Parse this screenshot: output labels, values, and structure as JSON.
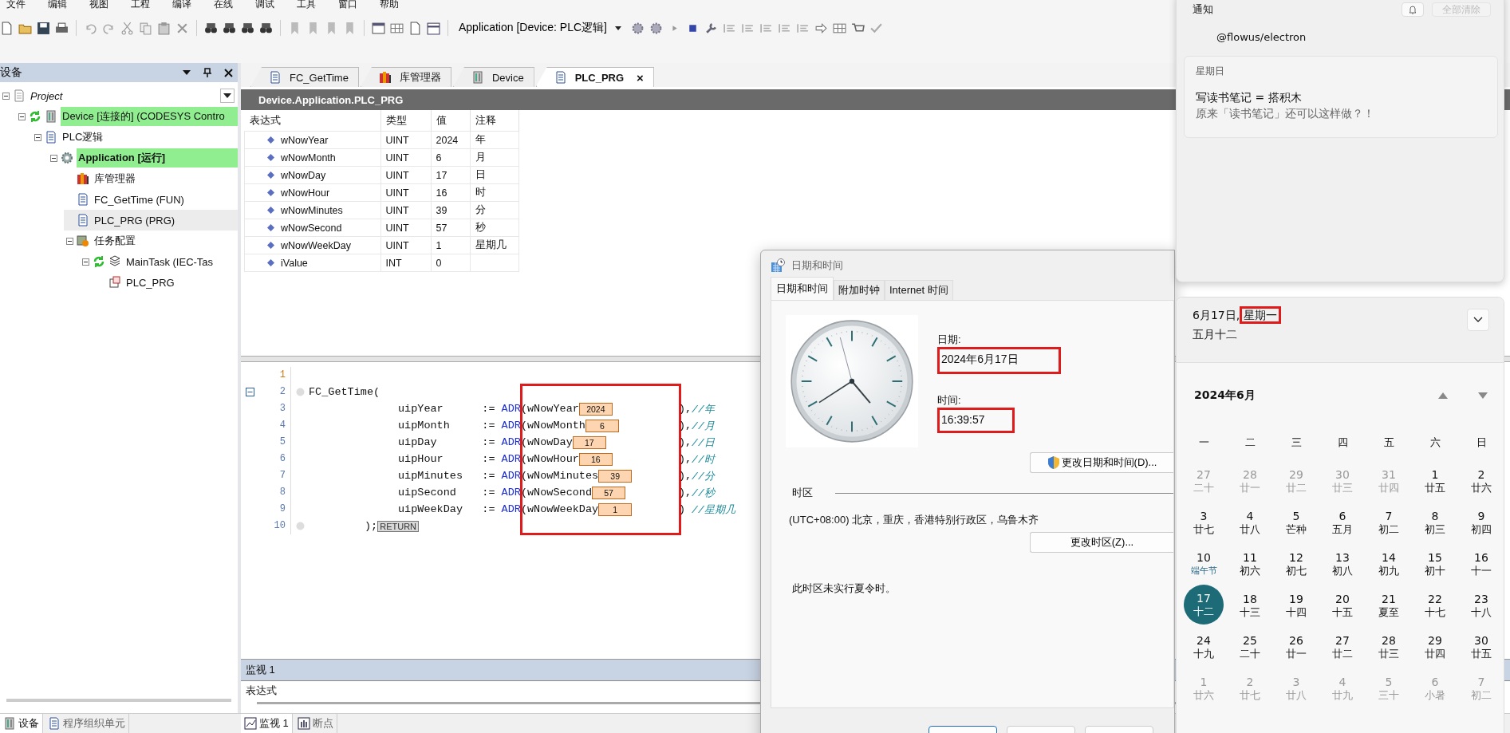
{
  "menu": [
    "文件",
    "编辑",
    "视图",
    "工程",
    "编译",
    "在线",
    "调试",
    "工具",
    "窗口",
    "帮助"
  ],
  "toolbar": {
    "target": "Application [Device: PLC逻辑]"
  },
  "devices_panel": {
    "title": "设备",
    "tree": [
      {
        "label": "Project",
        "kind": "project",
        "expanded": true,
        "selected": false,
        "highlight": false,
        "children": [
          {
            "label": "Device [连接的] (CODESYS Contro",
            "kind": "device",
            "expanded": true,
            "selected": false,
            "highlight": true,
            "children": [
              {
                "label": "PLC逻辑",
                "kind": "plc",
                "expanded": true,
                "selected": false,
                "highlight": false,
                "children": [
                  {
                    "label": "Application [运行]",
                    "kind": "application",
                    "expanded": true,
                    "selected": false,
                    "highlight": true,
                    "children": [
                      {
                        "label": "库管理器",
                        "kind": "library",
                        "selected": false,
                        "highlight": false
                      },
                      {
                        "label": "FC_GetTime (FUN)",
                        "kind": "pou",
                        "selected": false,
                        "highlight": false
                      },
                      {
                        "label": "PLC_PRG (PRG)",
                        "kind": "pou",
                        "selected": true,
                        "highlight": false
                      },
                      {
                        "label": "任务配置",
                        "kind": "taskconfig",
                        "expanded": true,
                        "selected": false,
                        "highlight": false,
                        "children": [
                          {
                            "label": "MainTask (IEC-Tas",
                            "kind": "task",
                            "expanded": true,
                            "selected": false,
                            "highlight": false,
                            "children": [
                              {
                                "label": "PLC_PRG",
                                "kind": "call",
                                "selected": false,
                                "highlight": false
                              }
                            ]
                          }
                        ]
                      }
                    ]
                  }
                ]
              }
            ]
          }
        ]
      }
    ]
  },
  "left_tabs": [
    {
      "label": "设备",
      "selected": true
    },
    {
      "label": "程序组织单元",
      "selected": false
    }
  ],
  "editor_tabs": [
    {
      "label": "FC_GetTime",
      "kind": "pou",
      "selected": false
    },
    {
      "label": "库管理器",
      "kind": "library",
      "selected": false
    },
    {
      "label": "Device",
      "kind": "device",
      "selected": false
    },
    {
      "label": "PLC_PRG",
      "kind": "pou",
      "selected": true,
      "close": "×"
    }
  ],
  "variables": {
    "path": "Device.Application.PLC_PRG",
    "columns": [
      "表达式",
      "类型",
      "值",
      "注释"
    ],
    "rows": [
      {
        "name": "wNowYear",
        "type": "UINT",
        "value": "2024",
        "comment": "年"
      },
      {
        "name": "wNowMonth",
        "type": "UINT",
        "value": "6",
        "comment": "月"
      },
      {
        "name": "wNowDay",
        "type": "UINT",
        "value": "17",
        "comment": "日"
      },
      {
        "name": "wNowHour",
        "type": "UINT",
        "value": "16",
        "comment": "时"
      },
      {
        "name": "wNowMinutes",
        "type": "UINT",
        "value": "39",
        "comment": "分"
      },
      {
        "name": "wNowSecond",
        "type": "UINT",
        "value": "57",
        "comment": "秒"
      },
      {
        "name": "wNowWeekDay",
        "type": "UINT",
        "value": "1",
        "comment": "星期几"
      },
      {
        "name": "iValue",
        "type": "INT",
        "value": "0"
      }
    ]
  },
  "code": {
    "highlighted": true,
    "lines": [
      {
        "number": "1",
        "kind": "blank"
      },
      {
        "number": "2",
        "kind": "call",
        "text": "FC_GetTime("
      },
      {
        "number": "3",
        "kind": "arg",
        "param": "uipYear",
        "op": ":=",
        "func": "ADR",
        "var": "(wNowYear",
        "value": "2024",
        "close": "),",
        "comment": "//年"
      },
      {
        "number": "4",
        "kind": "arg",
        "param": "uipMonth",
        "op": ":=",
        "func": "ADR",
        "var": "(wNowMonth",
        "value": "6",
        "close": "),",
        "comment": "//月"
      },
      {
        "number": "5",
        "kind": "arg",
        "param": "uipDay",
        "op": ":=",
        "func": "ADR",
        "var": "(wNowDay",
        "value": "17",
        "close": "),",
        "comment": "//日"
      },
      {
        "number": "6",
        "kind": "arg",
        "param": "uipHour",
        "op": ":=",
        "func": "ADR",
        "var": "(wNowHour",
        "value": "16",
        "close": "),",
        "comment": "//时"
      },
      {
        "number": "7",
        "kind": "arg",
        "param": "uipMinutes",
        "op": ":=",
        "func": "ADR",
        "var": "(wNowMinutes",
        "value": "39",
        "close": "),",
        "comment": "//分"
      },
      {
        "number": "8",
        "kind": "arg",
        "param": "uipSecond",
        "op": ":=",
        "func": "ADR",
        "var": "(wNowSecond",
        "value": "57",
        "close": "),",
        "comment": "//秒"
      },
      {
        "number": "9",
        "kind": "arg",
        "param": "uipWeekDay",
        "op": ":=",
        "func": "ADR",
        "var": "(wNowWeekDay",
        "value": "1",
        "close": ")",
        "comment": "//星期几"
      },
      {
        "number": "10",
        "kind": "end",
        "text": ");",
        "keyword": "RETURN"
      }
    ]
  },
  "watch": {
    "title": "监视 1",
    "column": "表达式"
  },
  "bottom_tabs": [
    {
      "label": "监视 1",
      "selected": true
    },
    {
      "label": "断点",
      "selected": false
    }
  ],
  "dialog": {
    "title": "日期和时间",
    "tabs": [
      {
        "label": "日期和时间",
        "selected": true
      },
      {
        "label": "附加时钟",
        "selected": false
      },
      {
        "label": "Internet 时间",
        "selected": false
      }
    ],
    "date_label": "日期:",
    "date": "2024年6月17日",
    "date_highlighted": true,
    "time_label": "时间:",
    "time": "16:39:57",
    "time_highlighted": true,
    "change_datetime": "更改日期和时间(D)...",
    "timezone_group": "时区",
    "timezone": "(UTC+08:00) 北京，重庆，香港特别行政区，乌鲁木齐",
    "change_timezone": "更改时区(Z)...",
    "dst_note": "此时区未实行夏令时。"
  },
  "notifications": {
    "title": "通知",
    "clear_all": "全部清除",
    "clear_all_disabled": true,
    "app": "@flowus/electron",
    "cards": [
      {
        "day": "星期日",
        "title": "写读书笔记 = 搭积木",
        "body": "原来「读书笔记」还可以这样做？！"
      }
    ]
  },
  "calendar": {
    "date": "6月17日,",
    "weekday": "星期一",
    "weekday_highlighted": true,
    "lunar": "五月十二",
    "month": "2024年6月",
    "weekdays": [
      "一",
      "二",
      "三",
      "四",
      "五",
      "六",
      "日"
    ],
    "weeks": [
      [
        {
          "day": "27",
          "lunar": "二十",
          "in_month": false,
          "selected": false,
          "festival": false
        },
        {
          "day": "28",
          "lunar": "廿一",
          "in_month": false,
          "selected": false,
          "festival": false
        },
        {
          "day": "29",
          "lunar": "廿二",
          "in_month": false,
          "selected": false,
          "festival": false
        },
        {
          "day": "30",
          "lunar": "廿三",
          "in_month": false,
          "selected": false,
          "festival": false
        },
        {
          "day": "31",
          "lunar": "廿四",
          "in_month": false,
          "selected": false,
          "festival": false
        },
        {
          "day": "1",
          "lunar": "廿五",
          "in_month": true,
          "selected": false,
          "festival": false
        },
        {
          "day": "2",
          "lunar": "廿六",
          "in_month": true,
          "selected": false,
          "festival": false
        }
      ],
      [
        {
          "day": "3",
          "lunar": "廿七",
          "in_month": true,
          "selected": false,
          "festival": false
        },
        {
          "day": "4",
          "lunar": "廿八",
          "in_month": true,
          "selected": false,
          "festival": false
        },
        {
          "day": "5",
          "lunar": "芒种",
          "in_month": true,
          "selected": false,
          "festival": false
        },
        {
          "day": "6",
          "lunar": "五月",
          "in_month": true,
          "selected": false,
          "festival": false
        },
        {
          "day": "7",
          "lunar": "初二",
          "in_month": true,
          "selected": false,
          "festival": false
        },
        {
          "day": "8",
          "lunar": "初三",
          "in_month": true,
          "selected": false,
          "festival": false
        },
        {
          "day": "9",
          "lunar": "初四",
          "in_month": true,
          "selected": false,
          "festival": false
        }
      ],
      [
        {
          "day": "10",
          "lunar": "端午节",
          "in_month": true,
          "selected": false,
          "festival": true
        },
        {
          "day": "11",
          "lunar": "初六",
          "in_month": true,
          "selected": false,
          "festival": false
        },
        {
          "day": "12",
          "lunar": "初七",
          "in_month": true,
          "selected": false,
          "festival": false
        },
        {
          "day": "13",
          "lunar": "初八",
          "in_month": true,
          "selected": false,
          "festival": false
        },
        {
          "day": "14",
          "lunar": "初九",
          "in_month": true,
          "selected": false,
          "festival": false
        },
        {
          "day": "15",
          "lunar": "初十",
          "in_month": true,
          "selected": false,
          "festival": false
        },
        {
          "day": "16",
          "lunar": "十一",
          "in_month": true,
          "selected": false,
          "festival": false
        }
      ],
      [
        {
          "day": "17",
          "lunar": "十二",
          "in_month": true,
          "selected": true,
          "festival": false
        },
        {
          "day": "18",
          "lunar": "十三",
          "in_month": true,
          "selected": false,
          "festival": false
        },
        {
          "day": "19",
          "lunar": "十四",
          "in_month": true,
          "selected": false,
          "festival": false
        },
        {
          "day": "20",
          "lunar": "十五",
          "in_month": true,
          "selected": false,
          "festival": false
        },
        {
          "day": "21",
          "lunar": "夏至",
          "in_month": true,
          "selected": false,
          "festival": false
        },
        {
          "day": "22",
          "lunar": "十七",
          "in_month": true,
          "selected": false,
          "festival": false
        },
        {
          "day": "23",
          "lunar": "十八",
          "in_month": true,
          "selected": false,
          "festival": false
        }
      ],
      [
        {
          "day": "24",
          "lunar": "十九",
          "in_month": true,
          "selected": false,
          "festival": false
        },
        {
          "day": "25",
          "lunar": "二十",
          "in_month": true,
          "selected": false,
          "festival": false
        },
        {
          "day": "26",
          "lunar": "廿一",
          "in_month": true,
          "selected": false,
          "festival": false
        },
        {
          "day": "27",
          "lunar": "廿二",
          "in_month": true,
          "selected": false,
          "festival": false
        },
        {
          "day": "28",
          "lunar": "廿三",
          "in_month": true,
          "selected": false,
          "festival": false
        },
        {
          "day": "29",
          "lunar": "廿四",
          "in_month": true,
          "selected": false,
          "festival": false
        },
        {
          "day": "30",
          "lunar": "廿五",
          "in_month": true,
          "selected": false,
          "festival": false
        }
      ],
      [
        {
          "day": "1",
          "lunar": "廿六",
          "in_month": false,
          "selected": false,
          "festival": false
        },
        {
          "day": "2",
          "lunar": "廿七",
          "in_month": false,
          "selected": false,
          "festival": false
        },
        {
          "day": "3",
          "lunar": "廿八",
          "in_month": false,
          "selected": false,
          "festival": false
        },
        {
          "day": "4",
          "lunar": "廿九",
          "in_month": false,
          "selected": false,
          "festival": false
        },
        {
          "day": "5",
          "lunar": "三十",
          "in_month": false,
          "selected": false,
          "festival": false
        },
        {
          "day": "6",
          "lunar": "小暑",
          "in_month": false,
          "selected": false,
          "festival": false
        },
        {
          "day": "7",
          "lunar": "初二",
          "in_month": false,
          "selected": false,
          "festival": false
        }
      ]
    ]
  }
}
